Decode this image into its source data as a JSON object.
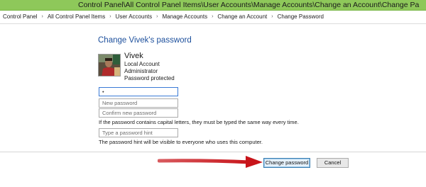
{
  "window": {
    "title": "Control Panel\\All Control Panel Items\\User Accounts\\Manage Accounts\\Change an Account\\Change Pa"
  },
  "breadcrumb": {
    "items": [
      "Control Panel",
      "All Control Panel Items",
      "User Accounts",
      "Manage Accounts",
      "Change an Account",
      "Change Password"
    ],
    "separator": "›"
  },
  "page": {
    "heading": "Change Vivek's password"
  },
  "account": {
    "name": "Vivek",
    "type": "Local Account",
    "role": "Administrator",
    "status": "Password protected"
  },
  "form": {
    "current_password_value": "•",
    "new_password_placeholder": "New password",
    "confirm_password_placeholder": "Confirm new password",
    "caps_note": "If the password contains capital letters, they must be typed the same way every time.",
    "hint_placeholder": "Type a password hint",
    "hint_note": "The password hint will be visible to everyone who uses this computer."
  },
  "buttons": {
    "change_password": "Change password",
    "cancel": "Cancel"
  },
  "colors": {
    "titlebar": "#8ec85a",
    "heading": "#1c4f9c",
    "arrow": "#c8141a"
  }
}
